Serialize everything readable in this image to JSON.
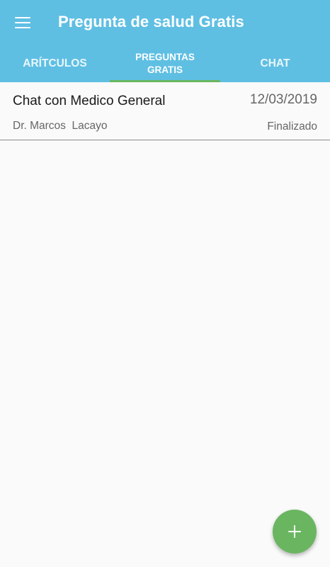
{
  "app_bar": {
    "title": "Pregunta de salud Gratis",
    "background_color": "#5fbfe3",
    "menu_icon": "menu-icon"
  },
  "tabs": [
    {
      "label": "ARÍTCULOS",
      "active": false
    },
    {
      "label_line1": "PREGUNTAS",
      "label_line2": "GRATIS",
      "active": true
    },
    {
      "label": "CHAT",
      "active": false
    }
  ],
  "tab_indicator_color": "#6ab660",
  "questions": [
    {
      "title": "Chat con Medico General",
      "date": "12/03/2019",
      "doctor": "Dr. Marcos  Lacayo",
      "status": "Finalizado"
    }
  ],
  "fab": {
    "icon": "plus-icon",
    "color": "#6ab660"
  }
}
